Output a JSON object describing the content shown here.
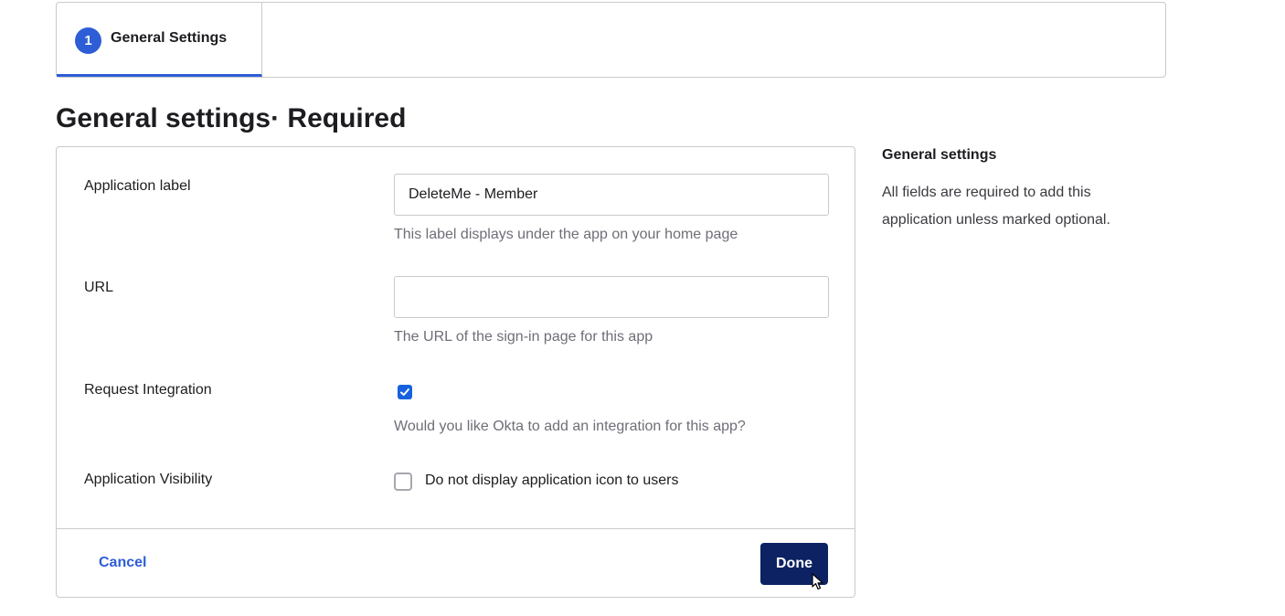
{
  "stepper": {
    "step_number": "1",
    "step_label": "General Settings"
  },
  "page": {
    "title": "General settings· Required"
  },
  "form": {
    "app_label": {
      "label": "Application label",
      "value": "DeleteMe - Member",
      "hint": "This label displays under the app on your home page"
    },
    "url": {
      "label": "URL",
      "value": "",
      "hint": "The URL of the sign-in page for this app"
    },
    "request_integration": {
      "label": "Request Integration",
      "checked": true,
      "hint": "Would you like Okta to add an integration for this app?"
    },
    "visibility": {
      "label": "Application Visibility",
      "checked": false,
      "option_text": "Do not display application icon to users"
    },
    "footer": {
      "cancel_label": "Cancel",
      "done_label": "Done"
    }
  },
  "side_panel": {
    "title": "General settings",
    "text": "All fields are required to add this application unless marked optional."
  },
  "icons": {
    "step_badge": "step-number-badge",
    "checkmark": "checkmark-icon",
    "cursor": "mouse-pointer-icon"
  },
  "colors": {
    "accent": "#2e5ed6",
    "primary_button": "#0d2263",
    "checkbox": "#1662dd"
  }
}
